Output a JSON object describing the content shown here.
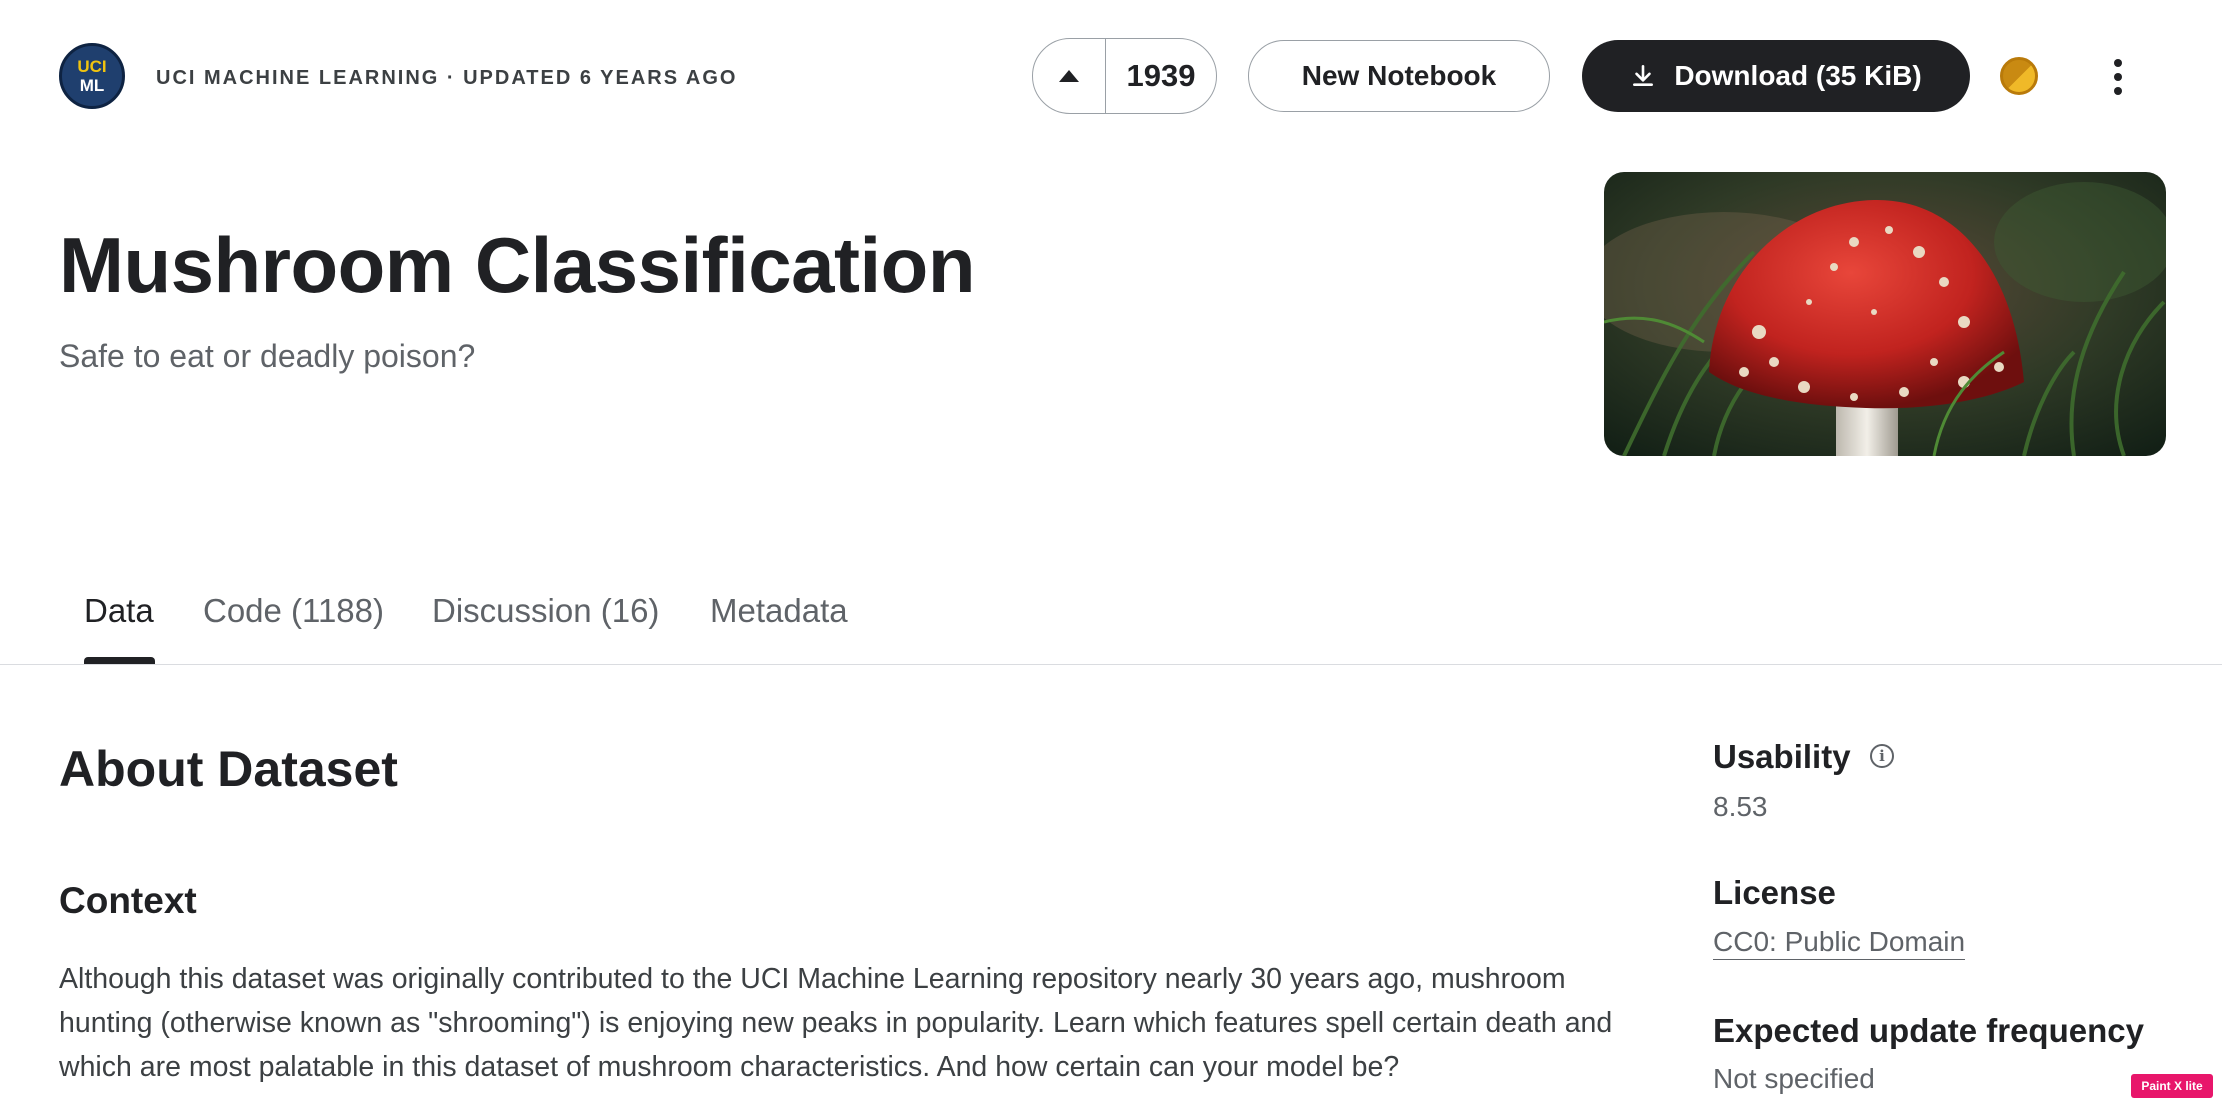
{
  "header": {
    "org_logo_top": "UCI",
    "org_logo_bottom": "ML",
    "meta_line": "UCI MACHINE LEARNING · UPDATED 6 YEARS AGO",
    "vote_count": "1939",
    "new_notebook_label": "New Notebook",
    "download_label": "Download (35 KiB)"
  },
  "hero": {
    "title": "Mushroom Classification",
    "subtitle": "Safe to eat or deadly poison?"
  },
  "tabs": [
    {
      "label": "Data",
      "active": true
    },
    {
      "label": "Code (1188)",
      "active": false
    },
    {
      "label": "Discussion (16)",
      "active": false
    },
    {
      "label": "Metadata",
      "active": false
    }
  ],
  "about": {
    "heading": "About Dataset",
    "context_heading": "Context",
    "context_text": "Although this dataset was originally contributed to the UCI Machine Learning repository nearly 30 years ago, mushroom hunting (otherwise known as \"shrooming\") is enjoying new peaks in popularity. Learn which features spell certain death and which are most palatable in this dataset of mushroom characteristics. And how certain can your model be?"
  },
  "sidebar": {
    "usability_label": "Usability",
    "usability_value": "8.53",
    "license_label": "License",
    "license_value": "CC0: Public Domain",
    "update_label": "Expected update frequency",
    "update_value": "Not specified"
  },
  "extension_badge": "Paint X lite",
  "colors": {
    "primary_dark": "#202124",
    "muted_text": "#5f6368",
    "border": "#dadce0",
    "badge": "#e8166b"
  },
  "icons": {
    "vote": "caret-up-icon",
    "download": "download-icon",
    "medal": "medal-icon",
    "menu": "more-vertical-icon",
    "info": "info-icon"
  }
}
